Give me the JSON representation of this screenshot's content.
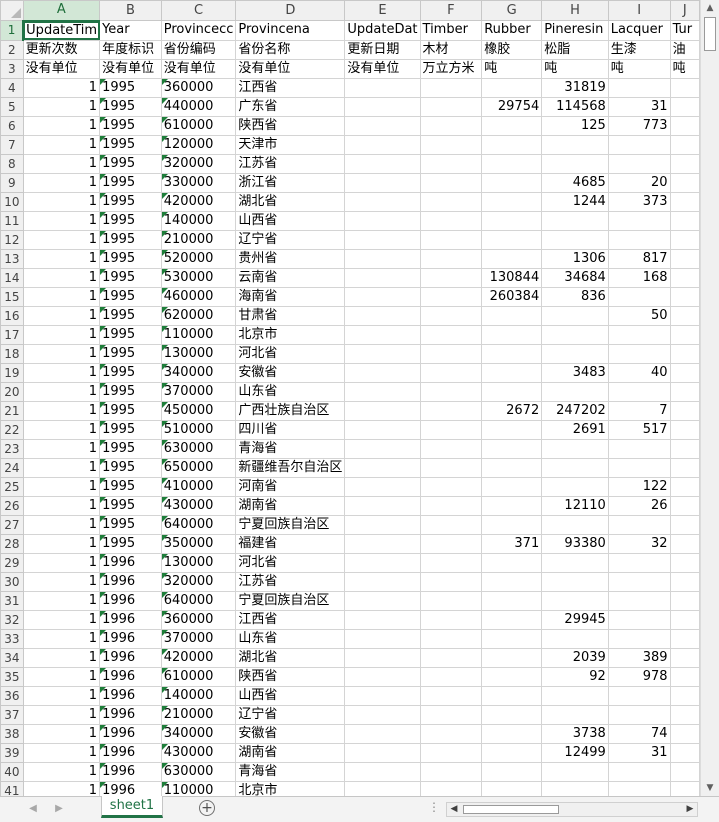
{
  "sheet": {
    "columns": [
      "A",
      "B",
      "C",
      "D",
      "E",
      "F",
      "G",
      "H",
      "I",
      "J"
    ],
    "active_column": "A",
    "active_row": 1,
    "rows": [
      {
        "n": "1",
        "c": [
          "UpdateTim",
          "Year",
          "Provincecc",
          "Provincena",
          "UpdateDat",
          "Timber",
          "Rubber",
          "Pineresin",
          "Lacquer",
          "Tur"
        ]
      },
      {
        "n": "2",
        "c": [
          "更新次数",
          "年度标识",
          "省份编码",
          "省份名称",
          "更新日期",
          "木材",
          "橡胶",
          "松脂",
          "生漆",
          "油"
        ]
      },
      {
        "n": "3",
        "c": [
          "没有单位",
          "没有单位",
          "没有单位",
          "没有单位",
          "没有单位",
          "万立方米",
          "吨",
          "吨",
          "吨",
          "吨"
        ]
      },
      {
        "n": "4",
        "c": [
          "1",
          "1995",
          "360000",
          "江西省",
          "",
          "",
          "",
          "31819",
          "",
          ""
        ]
      },
      {
        "n": "5",
        "c": [
          "1",
          "1995",
          "440000",
          "广东省",
          "",
          "",
          "29754",
          "114568",
          "31",
          ""
        ]
      },
      {
        "n": "6",
        "c": [
          "1",
          "1995",
          "610000",
          "陕西省",
          "",
          "",
          "",
          "125",
          "773",
          ""
        ]
      },
      {
        "n": "7",
        "c": [
          "1",
          "1995",
          "120000",
          "天津市",
          "",
          "",
          "",
          "",
          "",
          ""
        ]
      },
      {
        "n": "8",
        "c": [
          "1",
          "1995",
          "320000",
          "江苏省",
          "",
          "",
          "",
          "",
          "",
          ""
        ]
      },
      {
        "n": "9",
        "c": [
          "1",
          "1995",
          "330000",
          "浙江省",
          "",
          "",
          "",
          "4685",
          "20",
          ""
        ]
      },
      {
        "n": "10",
        "c": [
          "1",
          "1995",
          "420000",
          "湖北省",
          "",
          "",
          "",
          "1244",
          "373",
          ""
        ]
      },
      {
        "n": "11",
        "c": [
          "1",
          "1995",
          "140000",
          "山西省",
          "",
          "",
          "",
          "",
          "",
          ""
        ]
      },
      {
        "n": "12",
        "c": [
          "1",
          "1995",
          "210000",
          "辽宁省",
          "",
          "",
          "",
          "",
          "",
          ""
        ]
      },
      {
        "n": "13",
        "c": [
          "1",
          "1995",
          "520000",
          "贵州省",
          "",
          "",
          "",
          "1306",
          "817",
          ""
        ]
      },
      {
        "n": "14",
        "c": [
          "1",
          "1995",
          "530000",
          "云南省",
          "",
          "",
          "130844",
          "34684",
          "168",
          ""
        ]
      },
      {
        "n": "15",
        "c": [
          "1",
          "1995",
          "460000",
          "海南省",
          "",
          "",
          "260384",
          "836",
          "",
          ""
        ]
      },
      {
        "n": "16",
        "c": [
          "1",
          "1995",
          "620000",
          "甘肃省",
          "",
          "",
          "",
          "",
          "50",
          ""
        ]
      },
      {
        "n": "17",
        "c": [
          "1",
          "1995",
          "110000",
          "北京市",
          "",
          "",
          "",
          "",
          "",
          ""
        ]
      },
      {
        "n": "18",
        "c": [
          "1",
          "1995",
          "130000",
          "河北省",
          "",
          "",
          "",
          "",
          "",
          ""
        ]
      },
      {
        "n": "19",
        "c": [
          "1",
          "1995",
          "340000",
          "安徽省",
          "",
          "",
          "",
          "3483",
          "40",
          ""
        ]
      },
      {
        "n": "20",
        "c": [
          "1",
          "1995",
          "370000",
          "山东省",
          "",
          "",
          "",
          "",
          "",
          ""
        ]
      },
      {
        "n": "21",
        "c": [
          "1",
          "1995",
          "450000",
          "广西壮族自治区",
          "",
          "",
          "2672",
          "247202",
          "7",
          ""
        ]
      },
      {
        "n": "22",
        "c": [
          "1",
          "1995",
          "510000",
          "四川省",
          "",
          "",
          "",
          "2691",
          "517",
          ""
        ]
      },
      {
        "n": "23",
        "c": [
          "1",
          "1995",
          "630000",
          "青海省",
          "",
          "",
          "",
          "",
          "",
          ""
        ]
      },
      {
        "n": "24",
        "c": [
          "1",
          "1995",
          "650000",
          "新疆维吾尔自治区",
          "",
          "",
          "",
          "",
          "",
          ""
        ]
      },
      {
        "n": "25",
        "c": [
          "1",
          "1995",
          "410000",
          "河南省",
          "",
          "",
          "",
          "",
          "122",
          ""
        ]
      },
      {
        "n": "26",
        "c": [
          "1",
          "1995",
          "430000",
          "湖南省",
          "",
          "",
          "",
          "12110",
          "26",
          ""
        ]
      },
      {
        "n": "27",
        "c": [
          "1",
          "1995",
          "640000",
          "宁夏回族自治区",
          "",
          "",
          "",
          "",
          "",
          ""
        ]
      },
      {
        "n": "28",
        "c": [
          "1",
          "1995",
          "350000",
          "福建省",
          "",
          "",
          "371",
          "93380",
          "32",
          ""
        ]
      },
      {
        "n": "29",
        "c": [
          "1",
          "1996",
          "130000",
          "河北省",
          "",
          "",
          "",
          "",
          "",
          ""
        ]
      },
      {
        "n": "30",
        "c": [
          "1",
          "1996",
          "320000",
          "江苏省",
          "",
          "",
          "",
          "",
          "",
          ""
        ]
      },
      {
        "n": "31",
        "c": [
          "1",
          "1996",
          "640000",
          "宁夏回族自治区",
          "",
          "",
          "",
          "",
          "",
          ""
        ]
      },
      {
        "n": "32",
        "c": [
          "1",
          "1996",
          "360000",
          "江西省",
          "",
          "",
          "",
          "29945",
          "",
          ""
        ]
      },
      {
        "n": "33",
        "c": [
          "1",
          "1996",
          "370000",
          "山东省",
          "",
          "",
          "",
          "",
          "",
          ""
        ]
      },
      {
        "n": "34",
        "c": [
          "1",
          "1996",
          "420000",
          "湖北省",
          "",
          "",
          "",
          "2039",
          "389",
          ""
        ]
      },
      {
        "n": "35",
        "c": [
          "1",
          "1996",
          "610000",
          "陕西省",
          "",
          "",
          "",
          "92",
          "978",
          ""
        ]
      },
      {
        "n": "36",
        "c": [
          "1",
          "1996",
          "140000",
          "山西省",
          "",
          "",
          "",
          "",
          "",
          ""
        ]
      },
      {
        "n": "37",
        "c": [
          "1",
          "1996",
          "210000",
          "辽宁省",
          "",
          "",
          "",
          "",
          "",
          ""
        ]
      },
      {
        "n": "38",
        "c": [
          "1",
          "1996",
          "340000",
          "安徽省",
          "",
          "",
          "",
          "3738",
          "74",
          ""
        ]
      },
      {
        "n": "39",
        "c": [
          "1",
          "1996",
          "430000",
          "湖南省",
          "",
          "",
          "",
          "12499",
          "31",
          ""
        ]
      },
      {
        "n": "40",
        "c": [
          "1",
          "1996",
          "630000",
          "青海省",
          "",
          "",
          "",
          "",
          "",
          ""
        ]
      },
      {
        "n": "41",
        "c": [
          "1",
          "1996",
          "110000",
          "北京市",
          "",
          "",
          "",
          "",
          "",
          ""
        ]
      }
    ]
  },
  "sheet_tabs": [
    {
      "label": "sheet1",
      "active": true
    }
  ],
  "bottom_bar": {
    "add_sheet_symbol": "+",
    "more_symbol": "⋮",
    "prev_symbol": "◀",
    "next_symbol": "▶"
  },
  "scroll": {
    "up": "▲",
    "down": "▼",
    "left": "◀",
    "right": "▶"
  }
}
